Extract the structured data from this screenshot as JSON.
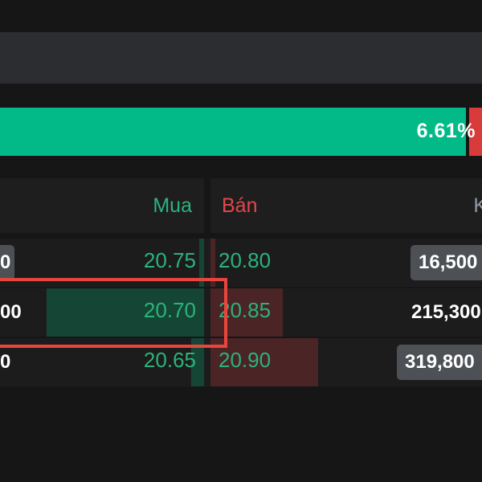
{
  "ratio": {
    "buy_ratio_label": "6.61%"
  },
  "header": {
    "buy_label": "Mua",
    "sell_label": "Bán",
    "third_label": "K"
  },
  "rows": [
    {
      "qty": "0",
      "buy_price": "20.75",
      "sell_price": "20.80",
      "sell_volume": "16,500"
    },
    {
      "qty": "00",
      "buy_price": "20.70",
      "sell_price": "20.85",
      "sell_volume": "215,300"
    },
    {
      "qty": "0",
      "buy_price": "20.65",
      "sell_price": "20.90",
      "sell_volume": "319,800"
    }
  ],
  "colors": {
    "buy": "#01ba87",
    "sell": "#d93a3a",
    "highlight": "#e8453c"
  }
}
